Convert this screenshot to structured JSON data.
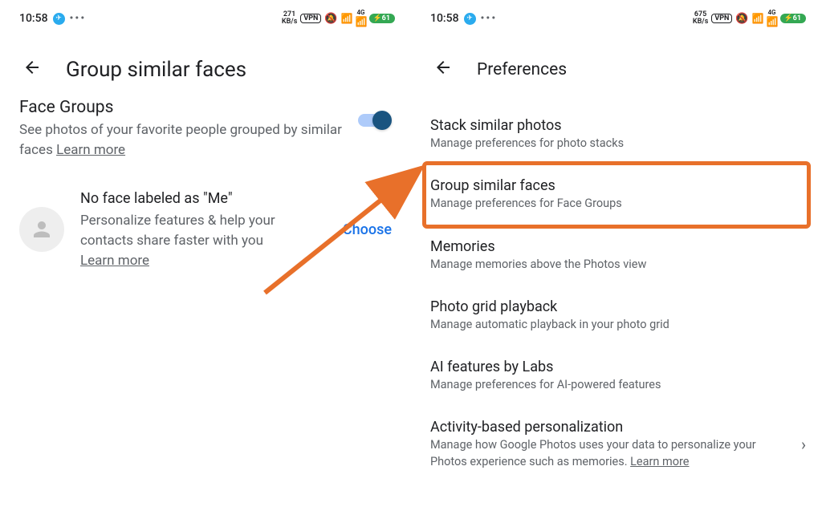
{
  "left": {
    "status": {
      "time": "10:58",
      "kbs_top": "271",
      "kbs_bottom": "KB/s",
      "vpn": "VPN",
      "net": "4G",
      "battery": "61"
    },
    "header": {
      "title": "Group similar faces"
    },
    "face_groups": {
      "title": "Face Groups",
      "desc_prefix": "See photos of your favorite people grouped by similar faces ",
      "learn": "Learn more"
    },
    "me_section": {
      "title": "No face labeled as \"Me\"",
      "desc": "Personalize features & help your contacts share faster with you",
      "learn": "Learn more",
      "choose": "Choose"
    }
  },
  "right": {
    "status": {
      "time": "10:58",
      "kbs_top": "675",
      "kbs_bottom": "KB/s",
      "vpn": "VPN",
      "net": "4G",
      "battery": "61"
    },
    "header": {
      "title": "Preferences"
    },
    "items": [
      {
        "title": "Stack similar photos",
        "desc": "Manage preferences for photo stacks"
      },
      {
        "title": "Group similar faces",
        "desc": "Manage preferences for Face Groups"
      },
      {
        "title": "Memories",
        "desc": "Manage memories above the Photos view"
      },
      {
        "title": "Photo grid playback",
        "desc": "Manage automatic playback in your photo grid"
      },
      {
        "title": "AI features by Labs",
        "desc": "Manage preferences for AI-powered features"
      },
      {
        "title": "Activity-based personalization",
        "desc": "Manage how Google Photos uses your data to personalize your Photos experience such as memories. ",
        "learn": "Learn more"
      }
    ]
  }
}
